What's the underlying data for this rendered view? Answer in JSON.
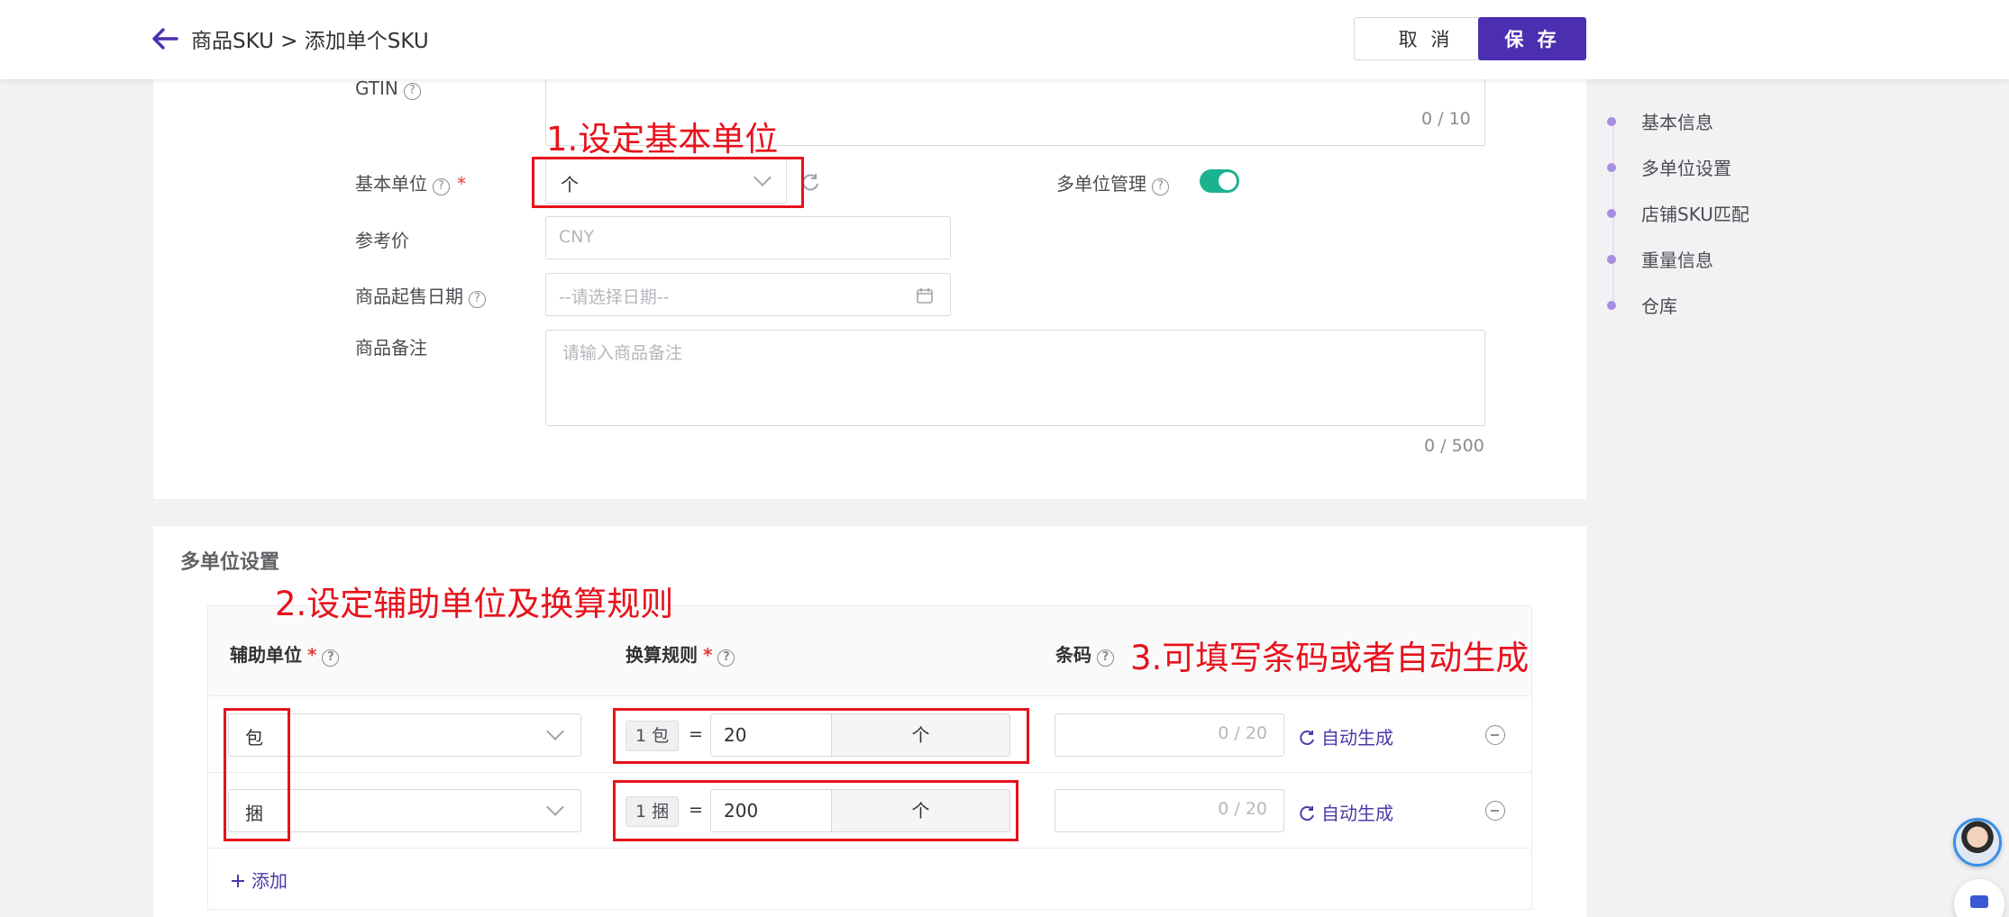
{
  "header": {
    "breadcrumb": "商品SKU > 添加单个SKU",
    "cancel_label": "取 消",
    "save_label": "保 存"
  },
  "form": {
    "gtin": {
      "label": "GTIN",
      "counter": "0 / 10"
    },
    "base_unit": {
      "label": "基本单位",
      "required": "*",
      "value": "个"
    },
    "multi_unit": {
      "label": "多单位管理",
      "enabled": true
    },
    "reference_price": {
      "label": "参考价",
      "placeholder": "CNY"
    },
    "sale_date": {
      "label": "商品起售日期",
      "placeholder": "--请选择日期--"
    },
    "remark": {
      "label": "商品备注",
      "placeholder": "请输入商品备注",
      "counter": "0 / 500"
    }
  },
  "anchor_nav": {
    "items": [
      {
        "label": "基本信息"
      },
      {
        "label": "多单位设置"
      },
      {
        "label": "店铺SKU匹配"
      },
      {
        "label": "重量信息"
      },
      {
        "label": "仓库"
      }
    ]
  },
  "multi_unit_section": {
    "title": "多单位设置",
    "columns": {
      "aux_unit": "辅助单位",
      "conversion": "换算规则",
      "barcode": "条码",
      "required": "*"
    },
    "rows": [
      {
        "aux_unit": "包",
        "chip": "1 包",
        "equals": "=",
        "qty": "20",
        "base_unit": "个",
        "barcode_counter": "0 / 20",
        "autogen": "自动生成"
      },
      {
        "aux_unit": "捆",
        "chip": "1 捆",
        "equals": "=",
        "qty": "200",
        "base_unit": "个",
        "barcode_counter": "0 / 20",
        "autogen": "自动生成"
      }
    ],
    "add_label": "添加"
  },
  "annotations": {
    "step1": "1.设定基本单位",
    "step2": "2.设定辅助单位及换算规则",
    "step3": "3.可填写条码或者自动生成"
  },
  "colors": {
    "primary": "#4b2fb0",
    "toggle_on": "#1bb38f",
    "annotation_red": "#e8121c",
    "link": "#4b3aa8"
  }
}
